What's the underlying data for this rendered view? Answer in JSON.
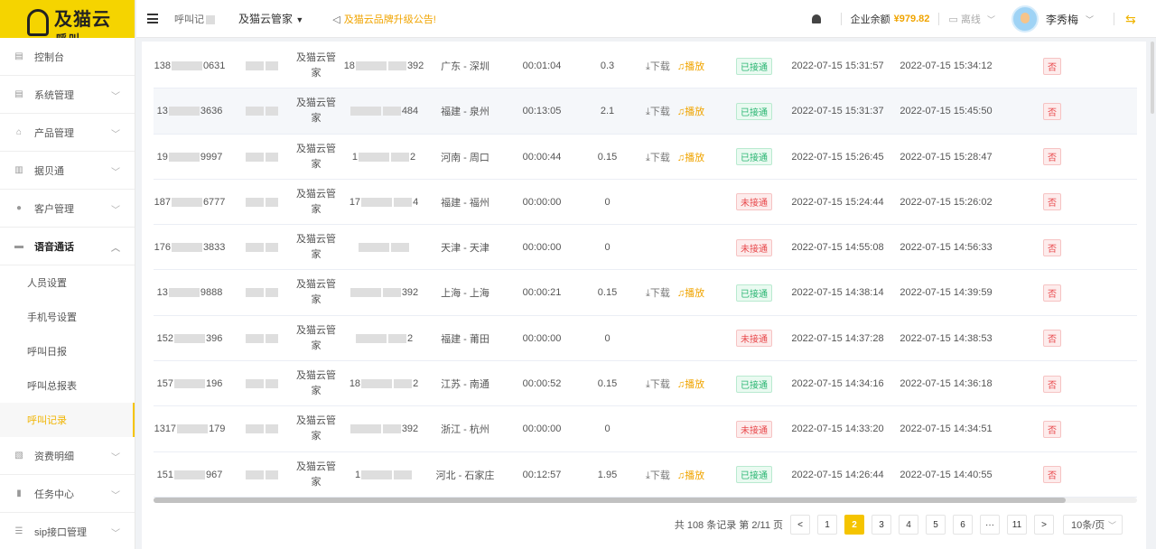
{
  "logo": {
    "text": "及猫云",
    "sub": "呼叫"
  },
  "sidebar": {
    "items": [
      {
        "label": "控制台",
        "icon": "dashboard-icon",
        "chev": ""
      },
      {
        "label": "系统管理",
        "icon": "doc-icon",
        "chev": "﹀"
      },
      {
        "label": "产品管理",
        "icon": "product-icon",
        "chev": "﹀"
      },
      {
        "label": "据贝通",
        "icon": "book-icon",
        "chev": "﹀"
      },
      {
        "label": "客户管理",
        "icon": "user-icon",
        "chev": "﹀"
      },
      {
        "label": "语音通话",
        "icon": "chat-icon",
        "chev": "︿"
      }
    ],
    "sub": [
      {
        "label": "人员设置"
      },
      {
        "label": "手机号设置"
      },
      {
        "label": "呼叫日报"
      },
      {
        "label": "呼叫总报表"
      },
      {
        "label": "呼叫记录"
      }
    ],
    "items_bottom": [
      {
        "label": "资费明细",
        "icon": "fee-icon",
        "chev": "﹀"
      },
      {
        "label": "任务中心",
        "icon": "task-icon",
        "chev": "﹀"
      },
      {
        "label": "sip接口管理",
        "icon": "sip-icon",
        "chev": "﹀"
      }
    ]
  },
  "header": {
    "tab": "呼叫记",
    "tenant": "及猫云管家",
    "notice": "及猫云品牌升级公告!",
    "balance_label": "企业余额",
    "balance": "¥979.82",
    "status": "离线",
    "user": "李秀梅"
  },
  "rows": [
    {
      "phone_a": "138",
      "phone_b": "0631",
      "tenant": "及猫云管家",
      "callee_a": "18",
      "callee_b": "392",
      "region": "广东 - 深圳",
      "dur": "00:01:04",
      "cost": "0.3",
      "dl": "下载",
      "play": "播放",
      "status": "已接通",
      "ok": true,
      "start": "2022-07-15 15:31:57",
      "end": "2022-07-15 15:34:12",
      "flag": "否"
    },
    {
      "phone_a": "13",
      "phone_b": "3636",
      "tenant": "及猫云管家",
      "callee_a": "",
      "callee_b": "484",
      "region": "福建 - 泉州",
      "dur": "00:13:05",
      "cost": "2.1",
      "dl": "下载",
      "play": "播放",
      "status": "已接通",
      "ok": true,
      "start": "2022-07-15 15:31:37",
      "end": "2022-07-15 15:45:50",
      "flag": "否"
    },
    {
      "phone_a": "19",
      "phone_b": "9997",
      "tenant": "及猫云管家",
      "callee_a": "1",
      "callee_b": "2",
      "region": "河南 - 周口",
      "dur": "00:00:44",
      "cost": "0.15",
      "dl": "下载",
      "play": "播放",
      "status": "已接通",
      "ok": true,
      "start": "2022-07-15 15:26:45",
      "end": "2022-07-15 15:28:47",
      "flag": "否"
    },
    {
      "phone_a": "187",
      "phone_b": "6777",
      "tenant": "及猫云管家",
      "callee_a": "17",
      "callee_b": "4",
      "region": "福建 - 福州",
      "dur": "00:00:00",
      "cost": "0",
      "dl": "",
      "play": "",
      "status": "未接通",
      "ok": false,
      "start": "2022-07-15 15:24:44",
      "end": "2022-07-15 15:26:02",
      "flag": "否"
    },
    {
      "phone_a": "176",
      "phone_b": "3833",
      "tenant": "及猫云管家",
      "callee_a": "",
      "callee_b": "",
      "region": "天津 - 天津",
      "dur": "00:00:00",
      "cost": "0",
      "dl": "",
      "play": "",
      "status": "未接通",
      "ok": false,
      "start": "2022-07-15 14:55:08",
      "end": "2022-07-15 14:56:33",
      "flag": "否"
    },
    {
      "phone_a": "13",
      "phone_b": "9888",
      "tenant": "及猫云管家",
      "callee_a": "",
      "callee_b": "392",
      "region": "上海 - 上海",
      "dur": "00:00:21",
      "cost": "0.15",
      "dl": "下载",
      "play": "播放",
      "status": "已接通",
      "ok": true,
      "start": "2022-07-15 14:38:14",
      "end": "2022-07-15 14:39:59",
      "flag": "否"
    },
    {
      "phone_a": "152",
      "phone_b": "396",
      "tenant": "及猫云管家",
      "callee_a": "",
      "callee_b": "2",
      "region": "福建 - 莆田",
      "dur": "00:00:00",
      "cost": "0",
      "dl": "",
      "play": "",
      "status": "未接通",
      "ok": false,
      "start": "2022-07-15 14:37:28",
      "end": "2022-07-15 14:38:53",
      "flag": "否"
    },
    {
      "phone_a": "157",
      "phone_b": "196",
      "tenant": "及猫云管家",
      "callee_a": "18",
      "callee_b": "2",
      "region": "江苏 - 南通",
      "dur": "00:00:52",
      "cost": "0.15",
      "dl": "下载",
      "play": "播放",
      "status": "已接通",
      "ok": true,
      "start": "2022-07-15 14:34:16",
      "end": "2022-07-15 14:36:18",
      "flag": "否"
    },
    {
      "phone_a": "1317",
      "phone_b": "179",
      "tenant": "及猫云管家",
      "callee_a": "",
      "callee_b": "392",
      "region": "浙江 - 杭州",
      "dur": "00:00:00",
      "cost": "0",
      "dl": "",
      "play": "",
      "status": "未接通",
      "ok": false,
      "start": "2022-07-15 14:33:20",
      "end": "2022-07-15 14:34:51",
      "flag": "否"
    },
    {
      "phone_a": "151",
      "phone_b": "967",
      "tenant": "及猫云管家",
      "callee_a": "1",
      "callee_b": "",
      "region": "河北 - 石家庄",
      "dur": "00:12:57",
      "cost": "1.95",
      "dl": "下载",
      "play": "播放",
      "status": "已接通",
      "ok": true,
      "start": "2022-07-15 14:26:44",
      "end": "2022-07-15 14:40:55",
      "flag": "否"
    }
  ],
  "pager": {
    "summary": "共 108 条记录 第 2/11 页",
    "prev": "<",
    "pages": [
      "1",
      "2",
      "3",
      "4",
      "5",
      "6",
      "···",
      "11"
    ],
    "active": "2",
    "next": ">",
    "size": "10条/页"
  },
  "colors": {
    "accent": "#f5c400",
    "ok": "#2bb673",
    "no": "#e8484b",
    "link": "#f0a400"
  }
}
